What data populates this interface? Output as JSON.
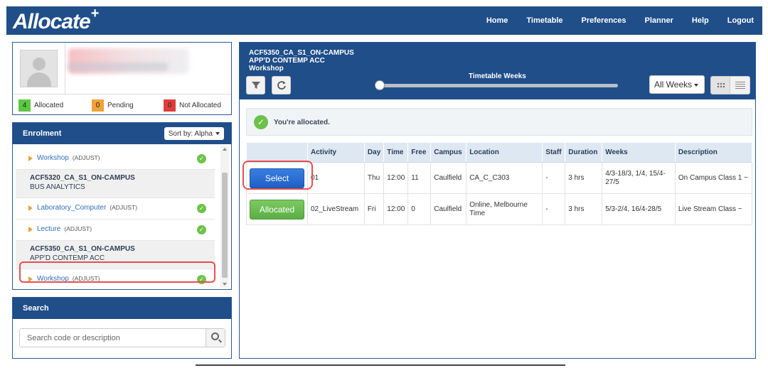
{
  "app": {
    "logo": "Allocate",
    "logo_plus": "+"
  },
  "nav": {
    "items": [
      "Home",
      "Timetable",
      "Preferences",
      "Planner",
      "Help",
      "Logout"
    ]
  },
  "stats": [
    {
      "count": "4",
      "label": "Allocated",
      "color": "#5cc743"
    },
    {
      "count": "0",
      "label": "Pending",
      "color": "#f0a13a"
    },
    {
      "count": "0",
      "label": "Not Allocated",
      "color": "#e03c3c"
    }
  ],
  "enrolment": {
    "title": "Enrolment",
    "sort_label": "Sort by: Alpha",
    "rows": [
      {
        "type": "activity",
        "name": "Workshop",
        "tag": "(ADJUST)",
        "status": "check-icon"
      },
      {
        "type": "subject",
        "code": "ACF5320_CA_S1_ON-CAMPUS",
        "desc": "BUS ANALYTICS"
      },
      {
        "type": "activity",
        "name": "Laboratory_Computer",
        "tag": "(ADJUST)",
        "status": "check-icon"
      },
      {
        "type": "activity",
        "name": "Lecture",
        "tag": "(ADJUST)",
        "status": "check-icon"
      },
      {
        "type": "subject",
        "code": "ACF5350_CA_S1_ON-CAMPUS",
        "desc": "APP'D CONTEMP ACC"
      },
      {
        "type": "activity",
        "name": "Workshop",
        "tag": "(ADJUST)",
        "status": "check-icon"
      }
    ]
  },
  "search": {
    "title": "Search",
    "placeholder": "Search code or description"
  },
  "main": {
    "code": "ACF5350_CA_S1_ON-CAMPUS",
    "subject": "APP'D CONTEMP ACC",
    "activity": "Workshop",
    "weeks_label": "Timetable Weeks",
    "weeks_dropdown": "All Weeks",
    "alert": "You're allocated.",
    "columns": [
      "",
      "Activity",
      "Day",
      "Time",
      "Free",
      "Campus",
      "Location",
      "Staff",
      "Duration",
      "Weeks",
      "Description"
    ],
    "rows": [
      {
        "button": "Select",
        "activity": "01",
        "day": "Thu",
        "time": "12:00",
        "free": "11",
        "campus": "Caulfield",
        "location": "CA_C_C303",
        "staff": "-",
        "duration": "3 hrs",
        "weeks": "4/3-18/3, 1/4, 15/4-27/5",
        "description": "On Campus Class 1 ~"
      },
      {
        "button": "Allocated",
        "activity": "02_LiveStream",
        "day": "Fri",
        "time": "12:00",
        "free": "0",
        "campus": "Caulfield",
        "location": "Online, Melbourne Time",
        "staff": "-",
        "duration": "3 hrs",
        "weeks": "5/3-2/4, 16/4-28/5",
        "description": "Live Stream Class ~"
      }
    ]
  }
}
